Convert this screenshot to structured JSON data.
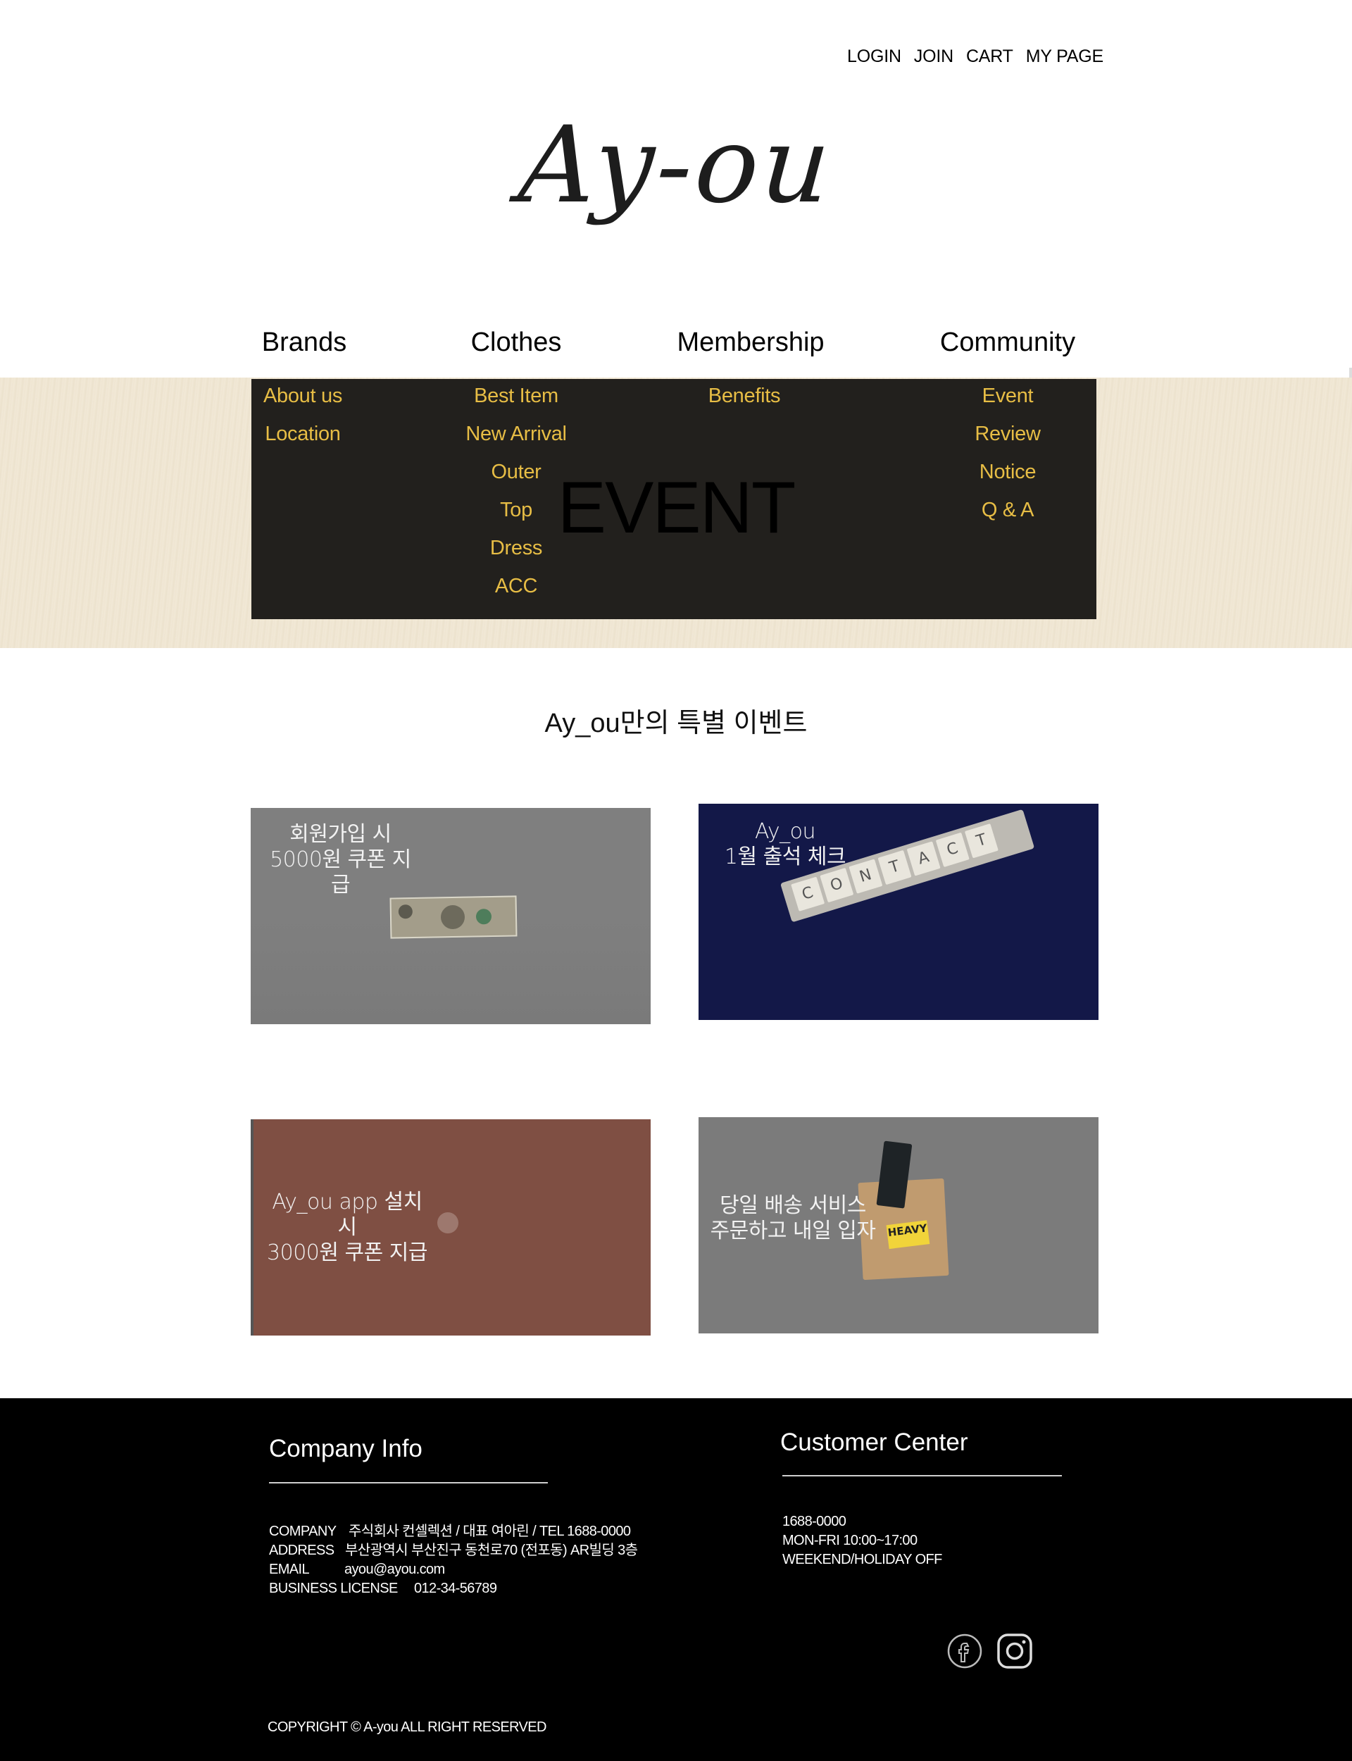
{
  "top_links": [
    "LOGIN",
    "JOIN",
    "CART",
    "MY PAGE"
  ],
  "logo": "Ay-ou",
  "nav": {
    "brands": "Brands",
    "clothes": "Clothes",
    "membership": "Membership",
    "community": "Community"
  },
  "dropdown": {
    "brands": [
      "About us",
      "Location"
    ],
    "clothes": [
      "Best Item",
      "New Arrival",
      "Outer",
      "Top",
      "Dress",
      "ACC"
    ],
    "membership": [
      "Benefits"
    ],
    "community": [
      "Event",
      "Review",
      "Notice",
      "Q & A"
    ]
  },
  "banner_title": "EVENT",
  "section_title": "Ay_ou만의 특별 이벤트",
  "cards": [
    {
      "line1": "회원가입 시",
      "line2": "5000원 쿠폰 지급"
    },
    {
      "line1": "Ay_ou",
      "line2": "1월 출석 체크",
      "tiles": [
        "C",
        "O",
        "N",
        "T",
        "A",
        "C",
        "T"
      ]
    },
    {
      "line1": "Ay_ou app 설치시",
      "line2": "3000원 쿠폰 지급"
    },
    {
      "line1": "당일 배송 서비스",
      "line2": "주문하고 내일 입자",
      "sticker": "HEAVY"
    }
  ],
  "footer": {
    "company_heading": "Company Info",
    "customer_heading": "Customer Center",
    "company_rows": [
      {
        "label": "COMPANY",
        "value": "주식회사 컨셀렉션 / 대표 여아린 / TEL 1688-0000"
      },
      {
        "label": "ADDRESS",
        "value": "부산광역시 부산진구 동천로70 (전포동) AR빌딩 3층"
      },
      {
        "label": "EMAIL",
        "value": "ayou@ayou.com"
      },
      {
        "label": "BUSINESS LICENSE",
        "value": "012-34-56789"
      }
    ],
    "customer_lines": [
      "1688-0000",
      "MON-FRI 10:00~17:00",
      "WEEKEND/HOLIDAY OFF"
    ],
    "copyright": "COPYRIGHT © A-you ALL RIGHT RESERVED"
  }
}
